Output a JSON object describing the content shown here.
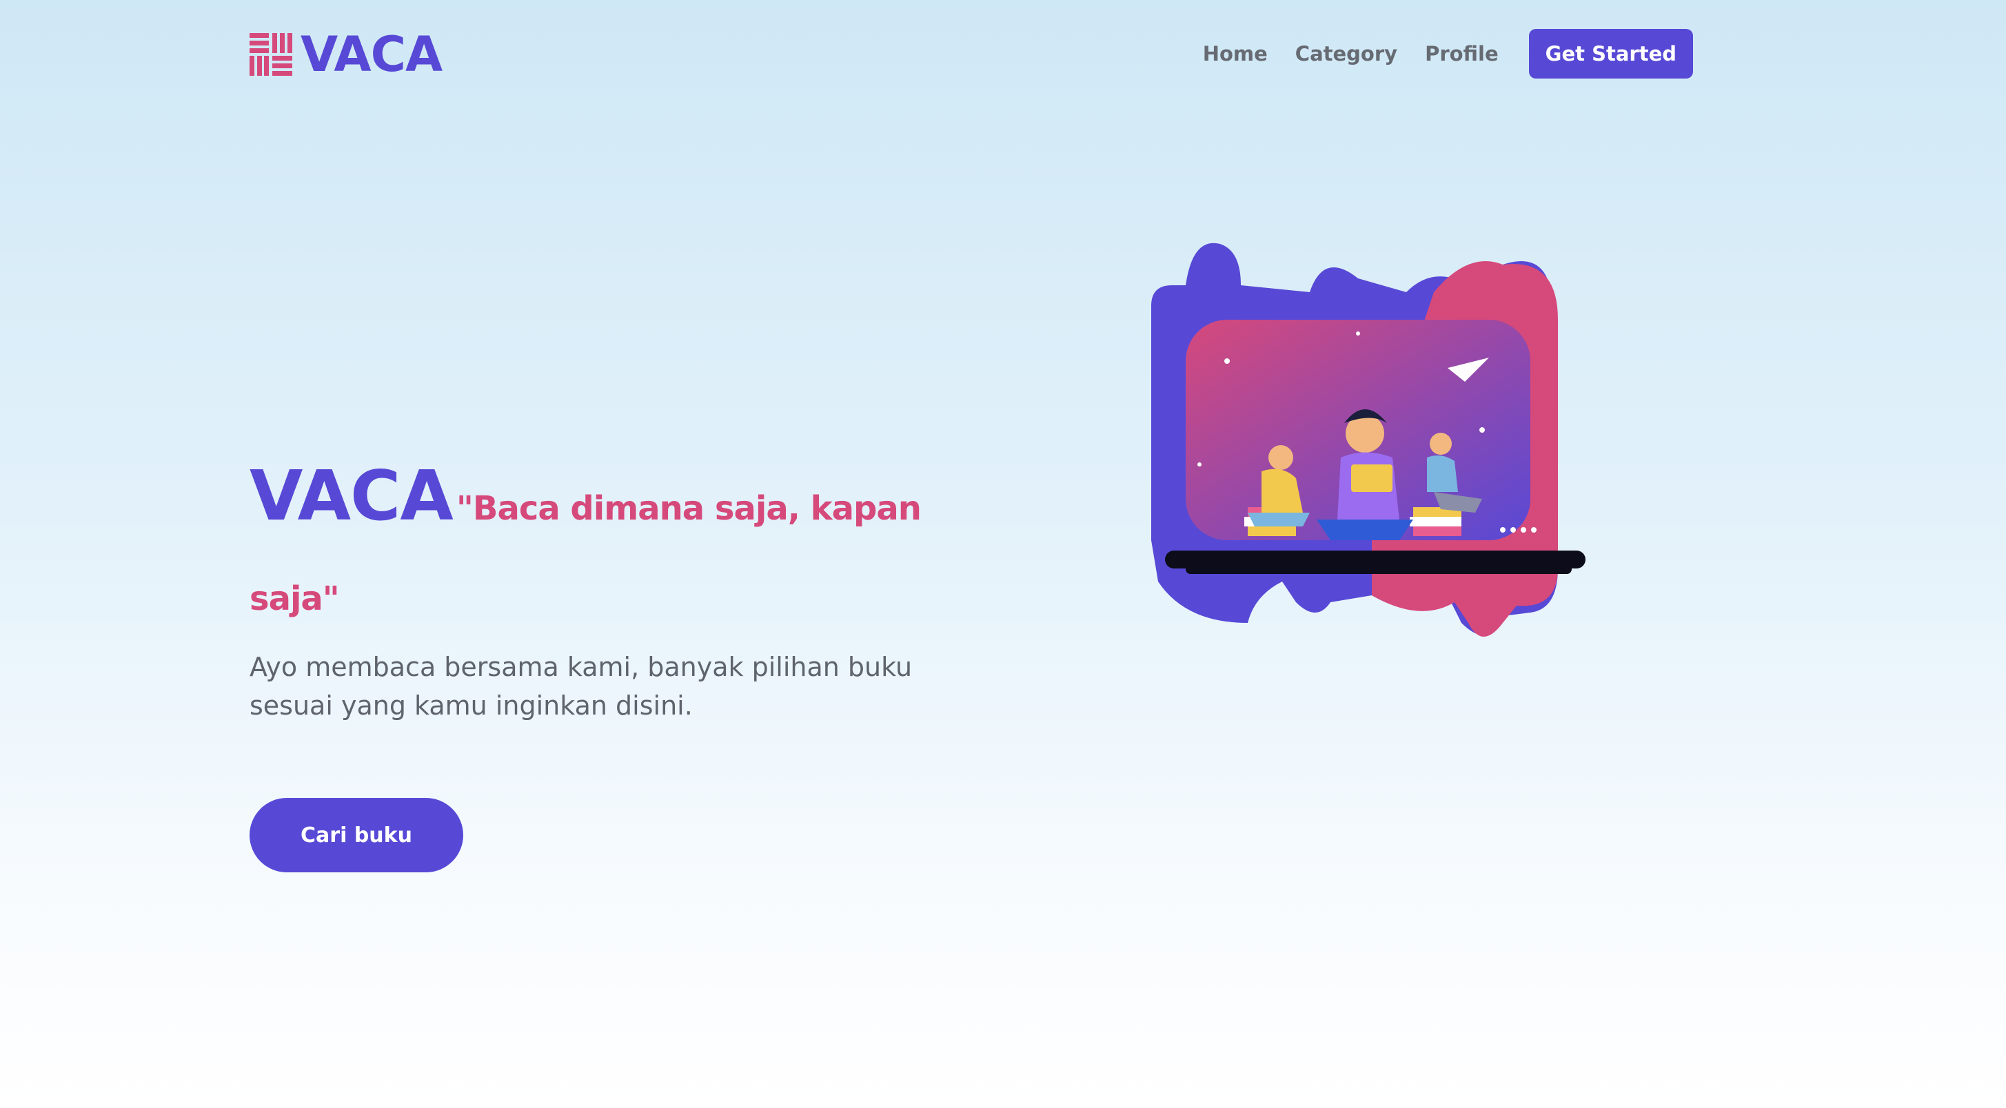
{
  "brand": {
    "name": "VACA"
  },
  "nav": {
    "items": [
      "Home",
      "Category",
      "Profile"
    ],
    "cta_label": "Get Started"
  },
  "hero": {
    "title": "VACA",
    "tagline": "\"Baca dimana saja, kapan saja\"",
    "description": "Ayo membaca bersama kami, banyak pilihan buku sesuai yang kamu inginkan disini.",
    "button_label": "Cari buku"
  },
  "colors": {
    "primary": "#5749d6",
    "accent": "#d6497b",
    "text_muted": "#5f646c"
  },
  "icons": {
    "logo_mark": "book-stack-icon",
    "illustration": "people-reading-illustration"
  }
}
